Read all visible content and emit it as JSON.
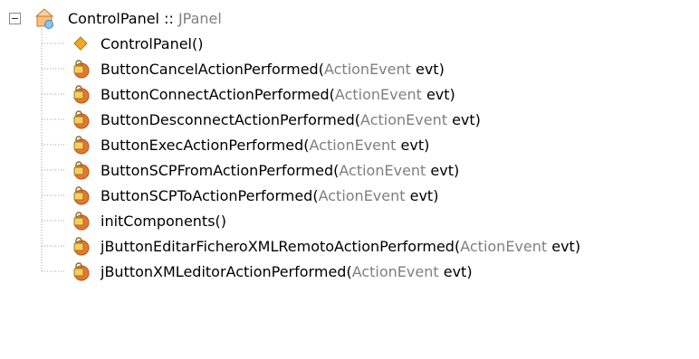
{
  "tree": {
    "root": {
      "name": "ControlPanel",
      "separator": " :: ",
      "type": "JPanel",
      "expanded": true,
      "icon": "class-icon"
    },
    "children": [
      {
        "name": "ControlPanel()",
        "param_type": "",
        "param_name": "",
        "suffix": "",
        "icon": "constructor-icon"
      },
      {
        "name": "ButtonCancelActionPerformed(",
        "param_type": "ActionEvent",
        "param_name": " evt",
        "suffix": ")",
        "icon": "private-method-icon"
      },
      {
        "name": "ButtonConnectActionPerformed(",
        "param_type": "ActionEvent",
        "param_name": " evt",
        "suffix": ")",
        "icon": "private-method-icon"
      },
      {
        "name": "ButtonDesconnectActionPerformed(",
        "param_type": "ActionEvent",
        "param_name": " evt",
        "suffix": ")",
        "icon": "private-method-icon"
      },
      {
        "name": "ButtonExecActionPerformed(",
        "param_type": "ActionEvent",
        "param_name": " evt",
        "suffix": ")",
        "icon": "private-method-icon"
      },
      {
        "name": "ButtonSCPFromActionPerformed(",
        "param_type": "ActionEvent",
        "param_name": " evt",
        "suffix": ")",
        "icon": "private-method-icon"
      },
      {
        "name": "ButtonSCPToActionPerformed(",
        "param_type": "ActionEvent",
        "param_name": " evt",
        "suffix": ")",
        "icon": "private-method-icon"
      },
      {
        "name": "initComponents()",
        "param_type": "",
        "param_name": "",
        "suffix": "",
        "icon": "private-method-icon"
      },
      {
        "name": "jButtonEditarFicheroXMLRemotoActionPerformed(",
        "param_type": "ActionEvent",
        "param_name": " evt",
        "suffix": ")",
        "icon": "private-method-icon"
      },
      {
        "name": "jButtonXMLeditorActionPerformed(",
        "param_type": "ActionEvent",
        "param_name": " evt",
        "suffix": ")",
        "icon": "private-method-icon"
      }
    ]
  },
  "colors": {
    "text": "#000000",
    "type_text": "#7f7f7f",
    "guide_line": "#a0a0a0",
    "method_icon": "#e8772c",
    "constructor_icon": "#f1a925",
    "class_icon": "#ffb36e"
  }
}
